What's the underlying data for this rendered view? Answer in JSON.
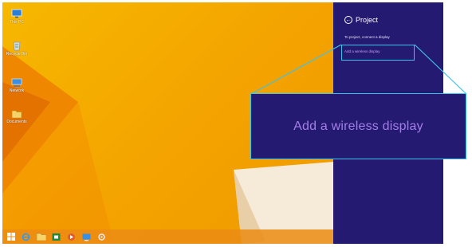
{
  "desktop": {
    "icons": [
      {
        "label": "This PC",
        "icon": "computer-icon"
      },
      {
        "label": "Recycle Bin",
        "icon": "recycle-bin-icon"
      },
      {
        "label": "Network",
        "icon": "network-icon"
      },
      {
        "label": "Documents",
        "icon": "folder-icon"
      }
    ]
  },
  "taskbar": {
    "buttons": [
      "start-icon",
      "ie-icon",
      "file-explorer-icon",
      "store-icon",
      "media-icon",
      "network-app-icon",
      "settings-icon"
    ]
  },
  "charm": {
    "title": "Project",
    "subtitle": "To project, connect a display",
    "link": "Add a wireless display"
  },
  "callout": {
    "text": "Add a wireless display"
  },
  "colors": {
    "desktop": "#f4a300",
    "charm_background": "#251a72",
    "highlight_border": "#3fc2e8",
    "link_text": "#a27ee6"
  }
}
